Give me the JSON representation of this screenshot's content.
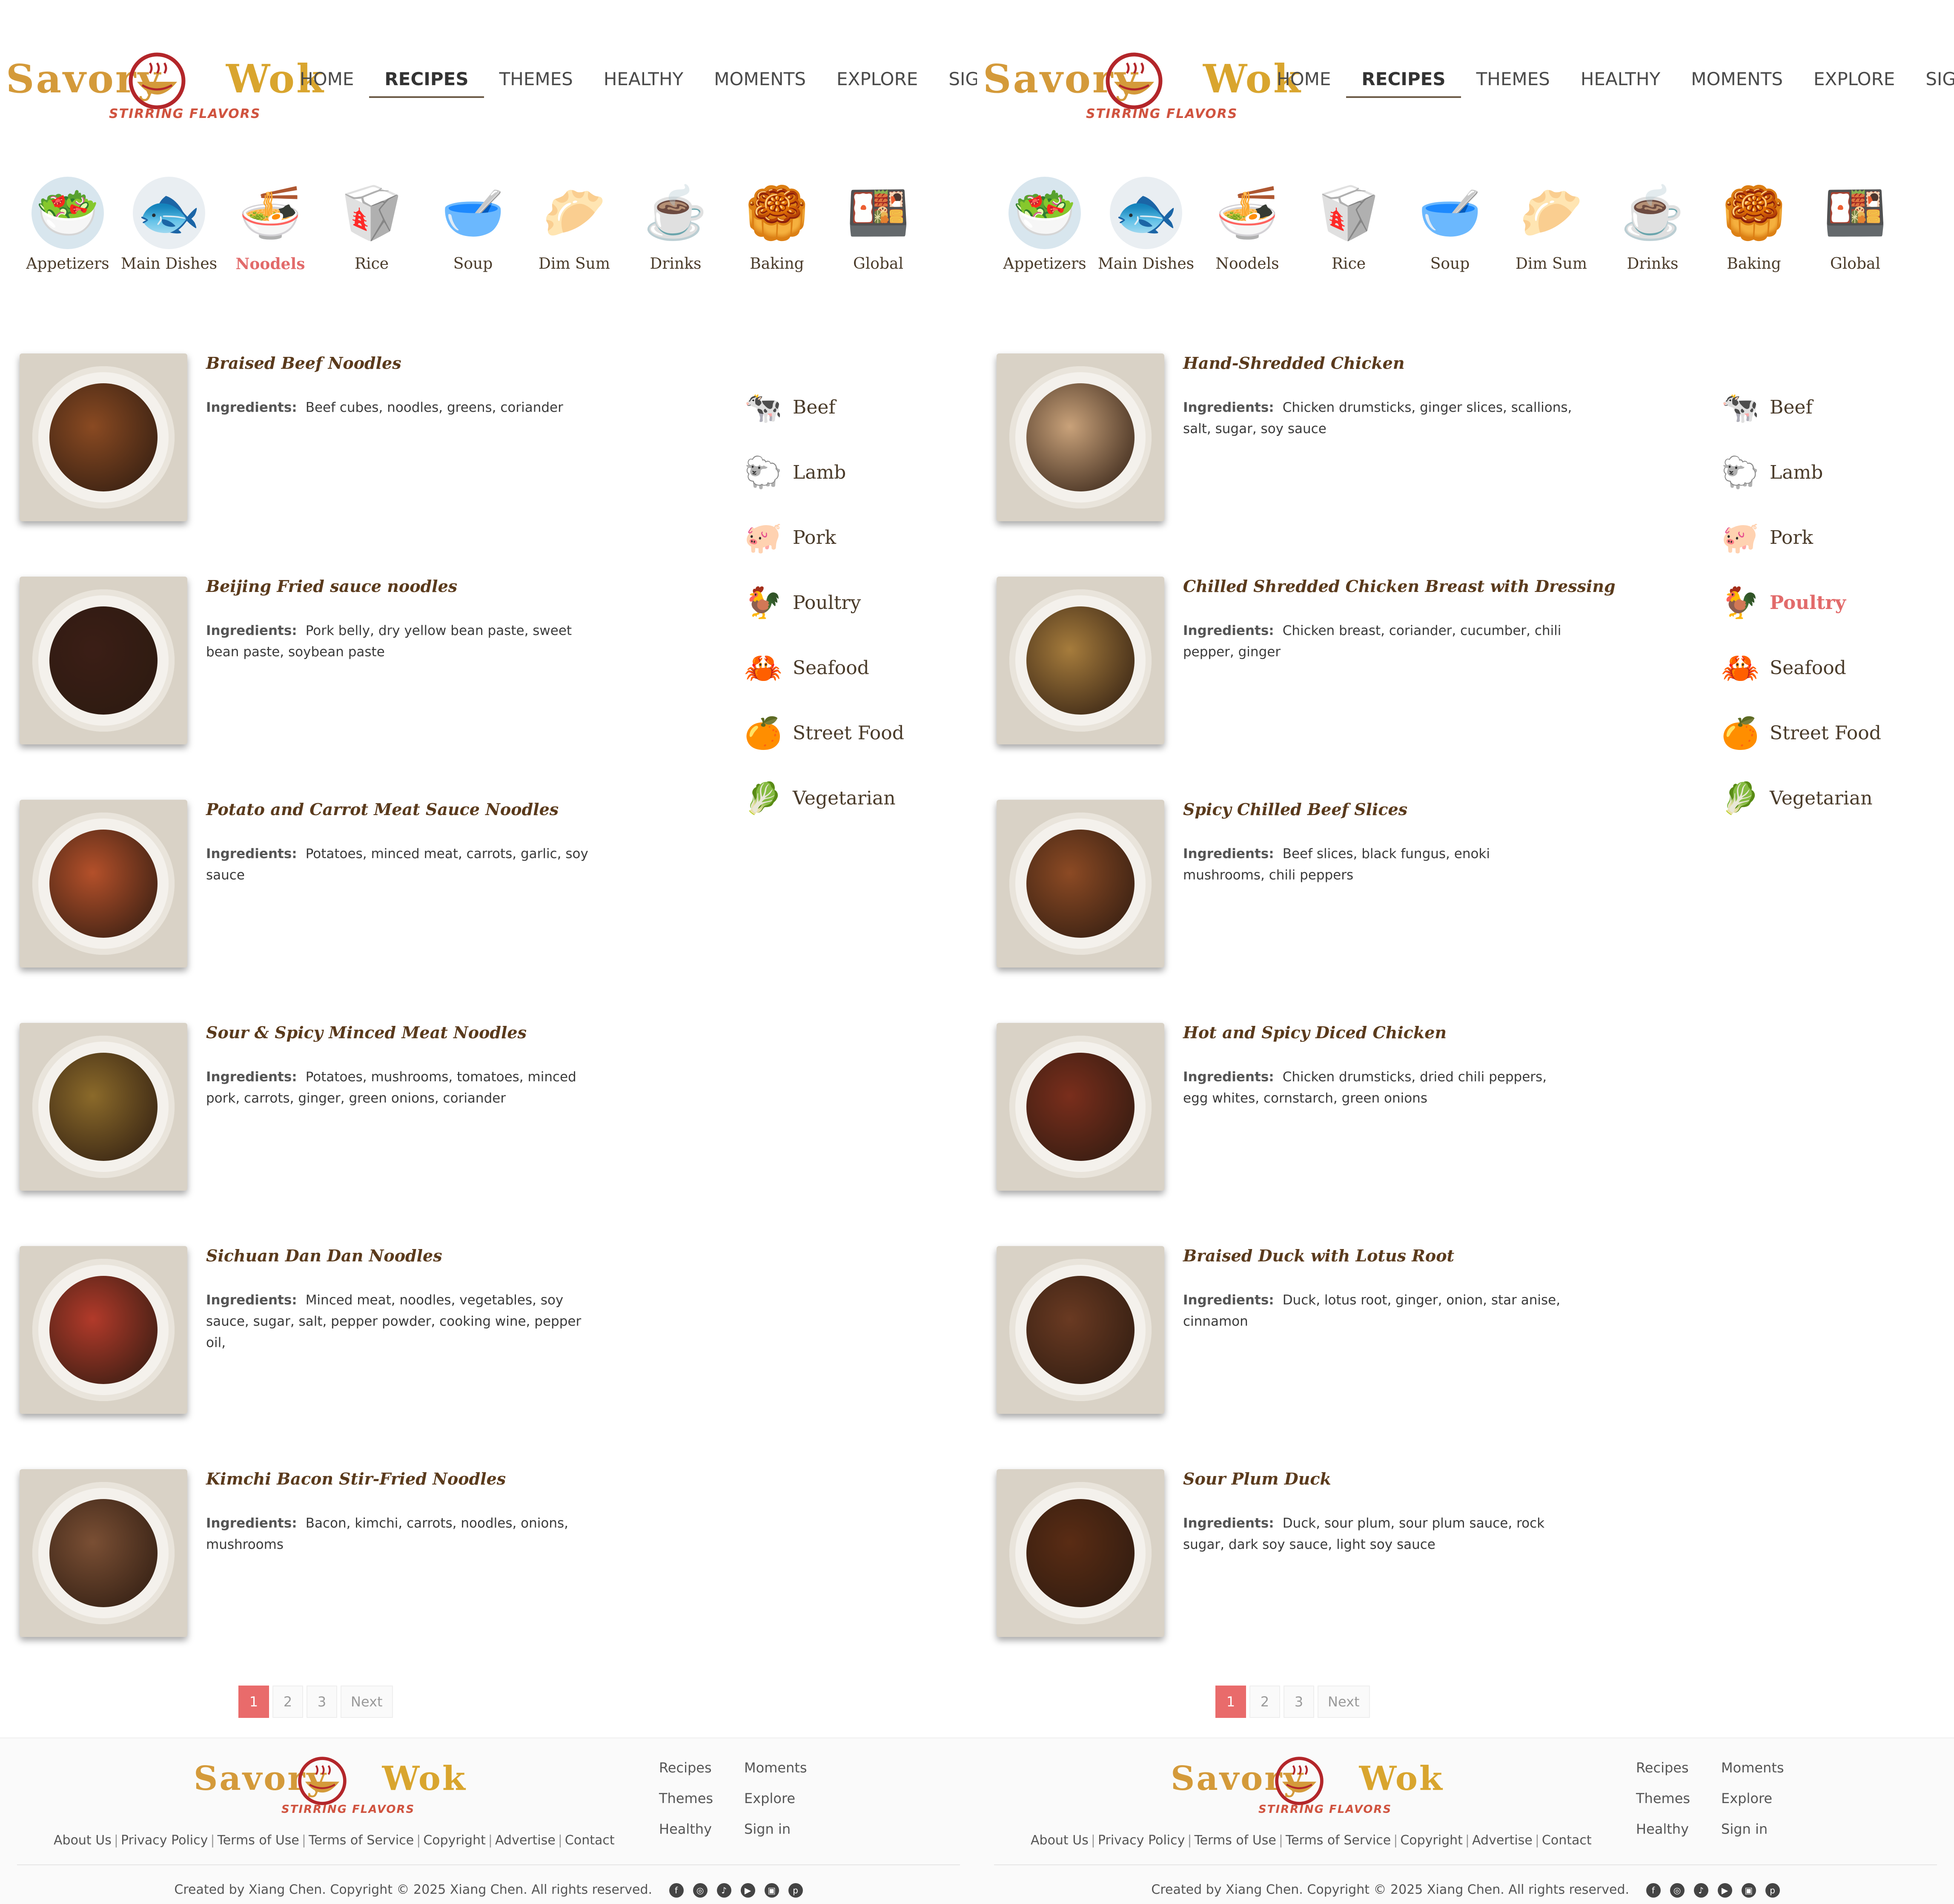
{
  "brand": {
    "name_left": "Savory",
    "name_right": "Wok",
    "tagline": "STIRRING FLAVORS"
  },
  "nav": [
    "HOME",
    "RECIPES",
    "THEMES",
    "HEALTHY",
    "MOMENTS",
    "EXPLORE",
    "SIGN IN"
  ],
  "categories": [
    {
      "label": "Appetizers",
      "icon": "appetizer-icon",
      "glyph": "🥗",
      "bg": "#d8e6ee"
    },
    {
      "label": "Main Dishes",
      "icon": "fish-dish-icon",
      "glyph": "🐟",
      "bg": "#e9eef2"
    },
    {
      "label": "Noodels",
      "icon": "noodle-bowl-icon",
      "glyph": "🍜",
      "bg": "#ffffff"
    },
    {
      "label": "Rice",
      "icon": "rice-box-icon",
      "glyph": "🥡",
      "bg": "#ffffff"
    },
    {
      "label": "Soup",
      "icon": "soup-bowl-icon",
      "glyph": "🥣",
      "bg": "#ffffff"
    },
    {
      "label": "Dim Sum",
      "icon": "dim-sum-icon",
      "glyph": "🥟",
      "bg": "#ffffff"
    },
    {
      "label": "Drinks",
      "icon": "drink-cup-icon",
      "glyph": "☕",
      "bg": "#ffffff"
    },
    {
      "label": "Baking",
      "icon": "baking-icon",
      "glyph": "🥮",
      "bg": "#ffffff"
    },
    {
      "label": "Global",
      "icon": "global-dish-icon",
      "glyph": "🍱",
      "bg": "#ffffff"
    }
  ],
  "sidebar": [
    {
      "label": "Beef",
      "icon": "cow-icon",
      "glyph": "🐄"
    },
    {
      "label": "Lamb",
      "icon": "sheep-icon",
      "glyph": "🐑"
    },
    {
      "label": "Pork",
      "icon": "pig-icon",
      "glyph": "🐖"
    },
    {
      "label": "Poultry",
      "icon": "chicken-icon",
      "glyph": "🐓"
    },
    {
      "label": "Seafood",
      "icon": "crab-icon",
      "glyph": "🦀"
    },
    {
      "label": "Street Food",
      "icon": "street-food-icon",
      "glyph": "🍊"
    },
    {
      "label": "Vegetarian",
      "icon": "vegetable-icon",
      "glyph": "🥬"
    }
  ],
  "ingredients_label": "Ingredients:",
  "left": {
    "active_category": "Noodels",
    "active_side": "",
    "recipes": [
      {
        "title": "Braised Beef Noodles",
        "ingredients": "Beef cubes, noodles, greens, coriander",
        "color": "#8a4a22"
      },
      {
        "title": "Beijing Fried sauce noodles",
        "ingredients": "Pork belly, dry yellow bean paste, sweet bean paste, soybean paste",
        "color": "#3b1e16"
      },
      {
        "title": "Potato and Carrot Meat Sauce Noodles",
        "ingredients": "Potatoes, minced meat, carrots, garlic, soy sauce",
        "color": "#b4502a"
      },
      {
        "title": "Sour & Spicy Minced Meat Noodles",
        "ingredients": "Potatoes, mushrooms, tomatoes, minced pork, carrots, ginger, green onions, coriander",
        "color": "#8b6a2a"
      },
      {
        "title": "Sichuan Dan Dan Noodles",
        "ingredients": "Minced meat, noodles, vegetables, soy sauce, sugar, salt, pepper powder, cooking wine, pepper oil,",
        "color": "#b23a2a"
      },
      {
        "title": "Kimchi Bacon Stir-Fried Noodles",
        "ingredients": "Bacon, kimchi, carrots, noodles, onions, mushrooms",
        "color": "#7a4f34"
      }
    ]
  },
  "right": {
    "active_category": "",
    "active_side": "Poultry",
    "recipes": [
      {
        "title": "Hand-Shredded Chicken",
        "ingredients": "Chicken drumsticks, ginger slices, scallions, salt, sugar, soy sauce",
        "color": "#c9a27a"
      },
      {
        "title": "Chilled Shredded Chicken Breast with Dressing",
        "ingredients": "Chicken breast, coriander, cucumber, chili pepper, ginger",
        "color": "#a67c3c"
      },
      {
        "title": "Spicy Chilled Beef Slices",
        "ingredients": "Beef slices, black fungus, enoki mushrooms, chili peppers",
        "color": "#8c4a24"
      },
      {
        "title": "Hot and Spicy Diced Chicken",
        "ingredients": "Chicken drumsticks, dried chili peppers, egg whites, cornstarch, green onions",
        "color": "#7a2e1c"
      },
      {
        "title": "Braised Duck with Lotus Root",
        "ingredients": "Duck, lotus root, ginger, onion, star anise, cinnamon",
        "color": "#6a3a22"
      },
      {
        "title": "Sour Plum Duck",
        "ingredients": "Duck, sour plum, sour plum sauce, rock sugar, dark soy sauce, light soy sauce",
        "color": "#5a2c14"
      }
    ]
  },
  "pagination": [
    "1",
    "2",
    "3",
    "Next"
  ],
  "footer": {
    "links": [
      "About Us",
      "Privacy Policy",
      "Terms of Use",
      "Terms of Service",
      "Copyright",
      "Advertise",
      "Contact"
    ],
    "menu": [
      "Recipes",
      "Moments",
      "Themes",
      "Explore",
      "Healthy",
      "Sign in"
    ],
    "copyright": "Created by Xiang Chen. Copyright © 2025 Xiang Chen. All rights reserved.",
    "socials": [
      {
        "icon": "facebook-icon",
        "glyph": "f"
      },
      {
        "icon": "instagram-icon",
        "glyph": "◎"
      },
      {
        "icon": "tiktok-icon",
        "glyph": "♪"
      },
      {
        "icon": "youtube-icon",
        "glyph": "▶"
      },
      {
        "icon": "flipboard-icon",
        "glyph": "▣"
      },
      {
        "icon": "pinterest-icon",
        "glyph": "p"
      }
    ]
  }
}
